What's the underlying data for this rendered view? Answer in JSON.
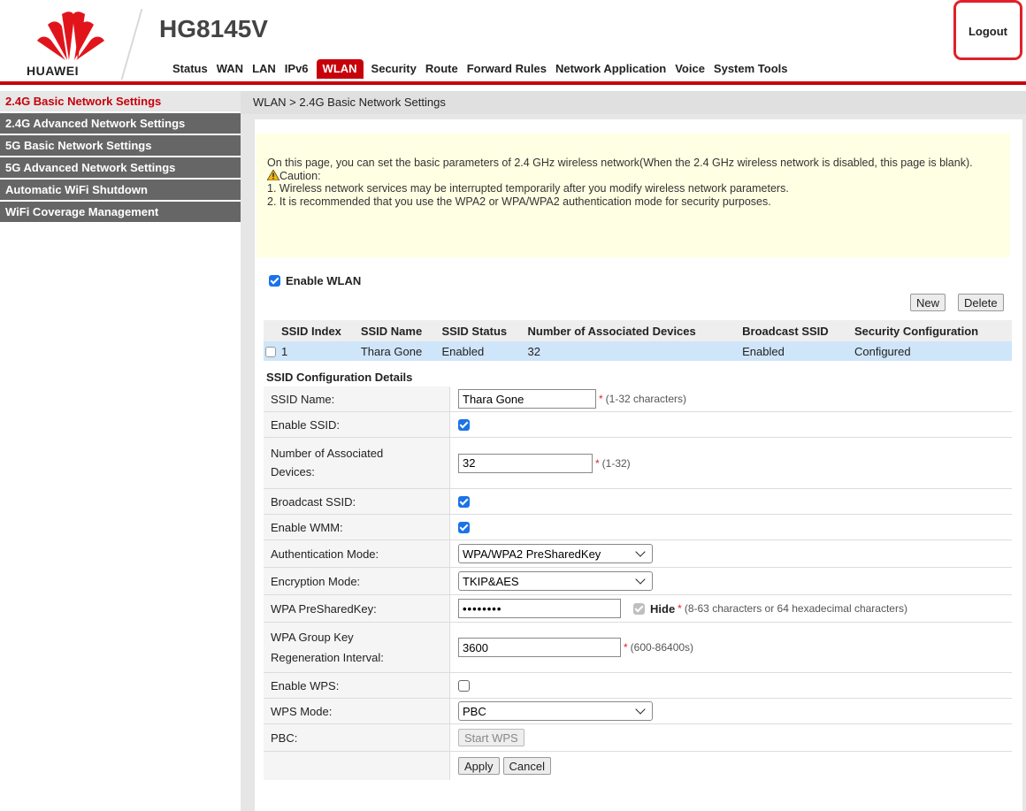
{
  "header": {
    "brand": "HUAWEI",
    "model": "HG8145V",
    "logout_label": "Logout",
    "colors": {
      "accent": "#c7000b",
      "sidebar": "#666666"
    }
  },
  "nav": {
    "tabs": [
      "Status",
      "WAN",
      "LAN",
      "IPv6",
      "WLAN",
      "Security",
      "Route",
      "Forward Rules",
      "Network Application",
      "Voice",
      "System Tools"
    ],
    "active": "WLAN"
  },
  "sidebar": {
    "items": [
      {
        "label": "2.4G Basic Network Settings",
        "active": true
      },
      {
        "label": "2.4G Advanced Network Settings",
        "active": false
      },
      {
        "label": "5G Basic Network Settings",
        "active": false
      },
      {
        "label": "5G Advanced Network Settings",
        "active": false
      },
      {
        "label": "Automatic WiFi Shutdown",
        "active": false
      },
      {
        "label": "WiFi Coverage Management",
        "active": false
      }
    ]
  },
  "breadcrumb": "WLAN > 2.4G Basic Network Settings",
  "info": {
    "text": "On this page, you can set the basic parameters of 2.4 GHz wireless network(When the 2.4 GHz wireless network is disabled, this page is blank).",
    "caution": "Caution:",
    "note1": "1. Wireless network services may be interrupted temporarily after you modify wireless network parameters.",
    "note2": "2. It is recommended that you use the WPA2 or WPA/WPA2 authentication mode for security purposes."
  },
  "enable_wlan": {
    "label": "Enable WLAN",
    "checked": true
  },
  "buttons": {
    "new": "New",
    "delete": "Delete",
    "apply": "Apply",
    "cancel": "Cancel",
    "start_wps": "Start WPS"
  },
  "ssid_table": {
    "headers": [
      "SSID Index",
      "SSID Name",
      "SSID Status",
      "Number of Associated Devices",
      "Broadcast SSID",
      "Security Configuration"
    ],
    "rows": [
      {
        "index": "1",
        "name": "Thara Gone",
        "status": "Enabled",
        "devices": "32",
        "broadcast": "Enabled",
        "security": "Configured"
      }
    ]
  },
  "details": {
    "title": "SSID Configuration Details",
    "ssid_name": {
      "label": "SSID Name:",
      "value": "Thara Gone",
      "hint": "(1-32 characters)"
    },
    "enable_ssid": {
      "label": "Enable SSID:",
      "checked": true
    },
    "assoc_devices": {
      "label1": "Number of Associated",
      "label2": "Devices:",
      "value": "32",
      "hint": "(1-32)"
    },
    "broadcast_ssid": {
      "label": "Broadcast SSID:",
      "checked": true
    },
    "enable_wmm": {
      "label": "Enable WMM:",
      "checked": true
    },
    "auth_mode": {
      "label": "Authentication Mode:",
      "value": "WPA/WPA2 PreSharedKey"
    },
    "encryption_mode": {
      "label": "Encryption Mode:",
      "value": "TKIP&AES"
    },
    "psk": {
      "label": "WPA PreSharedKey:",
      "value": "••••••••",
      "hide_label": "Hide",
      "hint": "(8-63 characters or 64 hexadecimal characters)"
    },
    "group_key": {
      "label1": "WPA Group Key",
      "label2": "Regeneration Interval:",
      "value": "3600",
      "hint": "(600-86400s)"
    },
    "enable_wps": {
      "label": "Enable WPS:",
      "checked": false
    },
    "wps_mode": {
      "label": "WPS Mode:",
      "value": "PBC"
    },
    "pbc": {
      "label": "PBC:"
    }
  }
}
